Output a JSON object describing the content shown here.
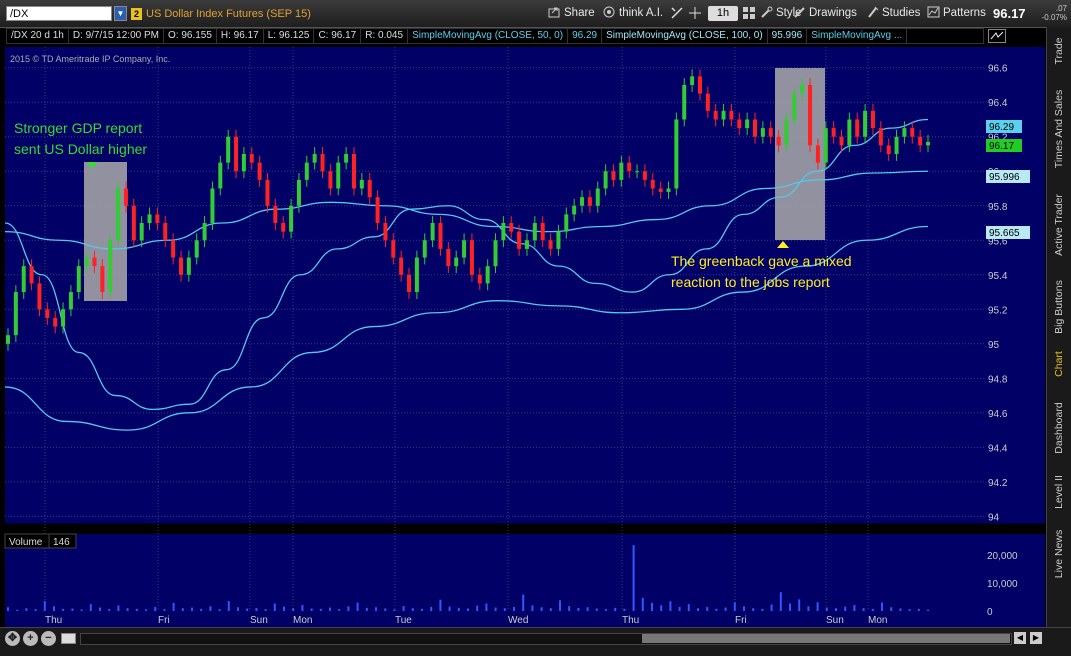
{
  "toolbar": {
    "symbol": "/DX",
    "link_badge": "2",
    "description": "US Dollar Index Futures (SEP 15)",
    "share": "Share",
    "think_ai": "think A.I.",
    "interval": "1h",
    "style": "Style",
    "drawings": "Drawings",
    "studies": "Studies",
    "patterns": "Patterns",
    "last_price": "96.17",
    "net_change": ".07",
    "net_change_pct": "-0.07%"
  },
  "header": {
    "period": "/DX 20 d 1h",
    "datetime": "D: 9/7/15 12:00 PM",
    "open": "O: 96.155",
    "high": "H: 96.17",
    "low": "L: 96.125",
    "close": "C: 96.17",
    "range": "R: 0.045",
    "sma50_label": "SimpleMovingAvg (CLOSE, 50, 0)",
    "sma50_value": "96.29",
    "sma100_label": "SimpleMovingAvg (CLOSE, 100, 0)",
    "sma100_value": "95.996",
    "sma3_label": "SimpleMovingAvg ..."
  },
  "copyright": "2015 © TD Ameritrade IP Company, Inc.",
  "annotations": {
    "gdp_line1": "Stronger GDP report",
    "gdp_line2": "sent US Dollar higher",
    "jobs_line1": "The greenback gave a mixed",
    "jobs_line2": "reaction to the jobs report"
  },
  "price_badges": {
    "sma50": "96.29",
    "last": "96.17",
    "sma100": "95.996",
    "sma200": "95.665"
  },
  "volume": {
    "label": "Volume",
    "value": "146",
    "ticks": [
      "20,000",
      "10,000",
      "0"
    ]
  },
  "sidebar": {
    "tabs": [
      "Trade",
      "Times And Sales",
      "Active Trader",
      "Big Buttons",
      "Chart",
      "Dashboard",
      "Level II",
      "Live News"
    ],
    "active": "Chart"
  },
  "colors": {
    "background": "#000066",
    "up": "#33cc33",
    "down": "#ff2222",
    "sma": "#55c8e8",
    "gdp_text": "#33dd33",
    "jobs_text": "#ffee22",
    "grid": "#3a3a88"
  },
  "chart_data": {
    "type": "candlestick",
    "x_labels": [
      "Thu",
      "Fri",
      "Sun",
      "Mon",
      "Tue",
      "Wed",
      "Thu",
      "Fri",
      "Sun",
      "Mon"
    ],
    "y_ticks": [
      94,
      94.2,
      94.4,
      94.6,
      94.8,
      95,
      95.2,
      95.4,
      95.6,
      95.8,
      96,
      96.2,
      96.4,
      96.6
    ],
    "ylim": [
      93.95,
      96.72
    ],
    "grid": true,
    "close": [
      95.05,
      95.3,
      95.45,
      95.35,
      95.2,
      95.15,
      95.1,
      95.2,
      95.3,
      95.45,
      95.5,
      95.45,
      95.3,
      95.6,
      95.9,
      95.8,
      95.6,
      95.7,
      95.75,
      95.7,
      95.6,
      95.5,
      95.4,
      95.5,
      95.6,
      95.7,
      95.9,
      96.05,
      96.2,
      96.0,
      96.1,
      96.05,
      95.95,
      95.8,
      95.7,
      95.65,
      95.8,
      95.95,
      96.05,
      96.1,
      96.0,
      95.9,
      96.05,
      96.1,
      95.9,
      95.95,
      95.85,
      95.7,
      95.6,
      95.5,
      95.4,
      95.3,
      95.5,
      95.6,
      95.7,
      95.55,
      95.45,
      95.5,
      95.6,
      95.4,
      95.35,
      95.45,
      95.6,
      95.7,
      95.65,
      95.55,
      95.6,
      95.7,
      95.6,
      95.55,
      95.65,
      95.75,
      95.8,
      95.85,
      95.8,
      95.9,
      96.0,
      95.95,
      96.05,
      96.0,
      96.0,
      95.95,
      95.9,
      95.88,
      95.9,
      96.3,
      96.5,
      96.55,
      96.45,
      96.35,
      96.3,
      96.35,
      96.3,
      96.25,
      96.3,
      96.2,
      96.25,
      96.2,
      96.15,
      96.3,
      96.45,
      96.5,
      96.15,
      96.05,
      96.25,
      96.2,
      96.15,
      96.3,
      96.2,
      96.35,
      96.25,
      96.15,
      96.1,
      96.2,
      96.25,
      96.2,
      96.15,
      96.17
    ],
    "sma50": [
      95.7,
      95.4,
      94.95,
      94.7,
      94.62,
      94.65,
      94.85,
      95.15,
      95.4,
      95.55,
      95.62,
      95.78,
      95.8,
      95.72,
      95.58,
      95.45,
      95.35,
      95.3,
      95.4,
      95.55,
      95.75,
      95.85,
      96.0,
      96.15,
      96.25,
      96.3
    ],
    "sma100": [
      95.65,
      95.6,
      95.55,
      95.6,
      95.7,
      95.78,
      95.82,
      95.8,
      95.75,
      95.68,
      95.65,
      95.68,
      95.72,
      95.8,
      95.9,
      95.95,
      95.99,
      96.0
    ],
    "sma200": [
      94.75,
      94.55,
      94.5,
      94.6,
      94.75,
      94.95,
      95.1,
      95.18,
      95.25,
      95.22,
      95.18,
      95.2,
      95.3,
      95.45,
      95.6,
      95.68
    ],
    "volume_ylim": [
      0,
      22000
    ],
    "volume": [
      1200,
      400,
      900,
      600,
      3200,
      1500,
      700,
      800,
      500,
      2200,
      1100,
      600,
      1800,
      900,
      700,
      500,
      1300,
      600,
      2600,
      900,
      1100,
      700,
      1500,
      600,
      3200,
      1200,
      800,
      1000,
      600,
      2400,
      1400,
      900,
      1900,
      800,
      700,
      1100,
      600,
      1500,
      2700,
      1000,
      1200,
      800,
      500,
      1600,
      900,
      700,
      1300,
      3600,
      1400,
      1000,
      800,
      1700,
      2400,
      1100,
      900,
      1300,
      5200,
      1800,
      1200,
      900,
      3400,
      1600,
      1000,
      1200,
      800,
      600,
      1000,
      700,
      21000,
      4200,
      2600,
      1800,
      3100,
      1300,
      2200,
      900,
      1300,
      700,
      1100,
      2800,
      1500,
      900,
      700,
      2100,
      6000,
      2400,
      3700,
      1500,
      2800,
      1100,
      900,
      1400,
      1900,
      900,
      700,
      2700,
      1200,
      800,
      600,
      700,
      400
    ]
  }
}
